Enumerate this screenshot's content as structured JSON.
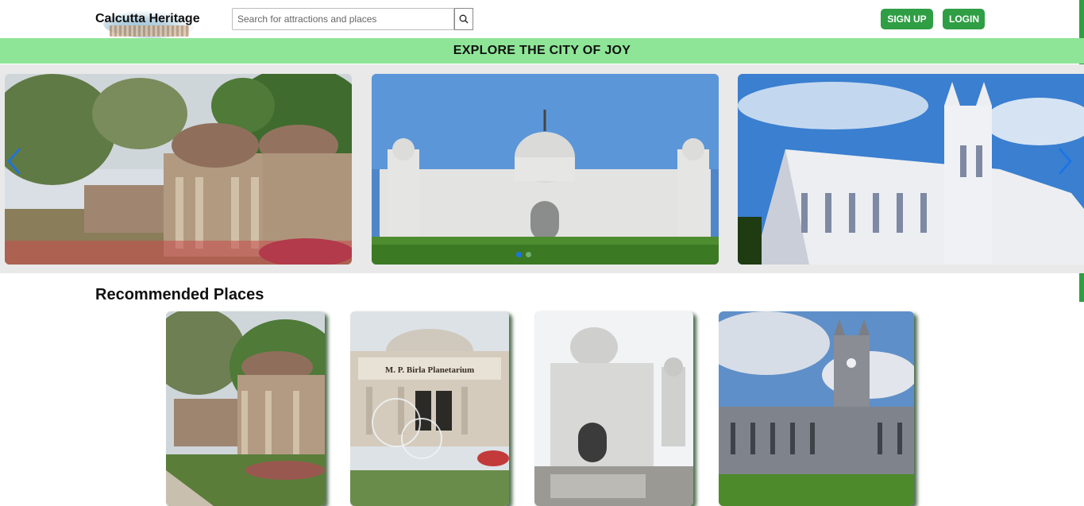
{
  "header": {
    "brand": "Calcutta Heritage",
    "search": {
      "placeholder": "Search for attractions and places",
      "value": "",
      "button_icon": "search-icon"
    },
    "signup_label": "SIGN UP",
    "login_label": "LOGIN"
  },
  "banner": {
    "text": "EXPLORE THE CITY OF JOY"
  },
  "carousel": {
    "slides": [
      {
        "image": "south-park-street-cemetery"
      },
      {
        "image": "victoria-memorial"
      },
      {
        "image": "st-pauls-cathedral"
      }
    ],
    "prev_icon": "chevron-left-icon",
    "next_icon": "chevron-right-icon",
    "active_index": 0,
    "dot_count": 2
  },
  "recommended": {
    "title": "Recommended Places",
    "cards": [
      {
        "image": "south-park-street-cemetery"
      },
      {
        "image": "birla-planetarium",
        "sign_text": "M. P. Birla Planetarium"
      },
      {
        "image": "victoria-memorial"
      },
      {
        "image": "st-pauls-cathedral"
      }
    ]
  },
  "colors": {
    "accent_green": "#2f9e44",
    "banner_green": "#8ee597",
    "carousel_bg": "#e9e9e9",
    "arrow_blue": "#1a73e8"
  }
}
